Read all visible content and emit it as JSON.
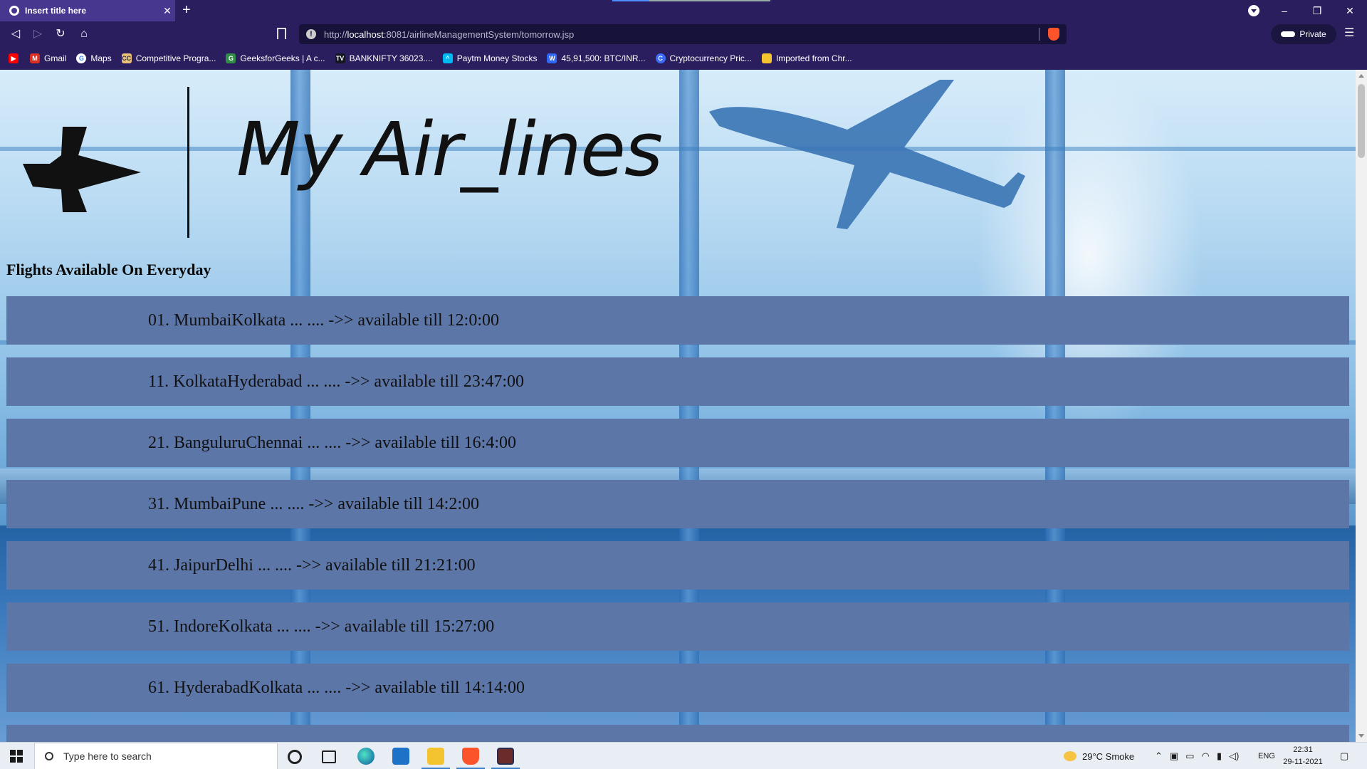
{
  "browser": {
    "tab_title": "Insert title here",
    "tab_close": "✕",
    "new_tab": "+",
    "url_prefix": "http://",
    "url_host": "localhost",
    "url_rest": ":8081/airlineManagementSystem/tomorrow.jsp",
    "private_label": "Private",
    "window_controls": {
      "minimize": "–",
      "restore": "❐",
      "close": "✕"
    },
    "bookmarks": [
      {
        "label": "Gmail",
        "icon": "gmail-icon",
        "color": "#d93025"
      },
      {
        "label": "Maps",
        "icon": "google-icon",
        "color": "#ffffff"
      },
      {
        "label": "Competitive Progra...",
        "icon": "codechef-icon",
        "color": "#e8c07a"
      },
      {
        "label": "GeeksforGeeks | A c...",
        "icon": "geeksforgeeks-icon",
        "color": "#2f8d46"
      },
      {
        "label": "BANKNIFTY 36023....",
        "icon": "tradingview-icon",
        "color": "#131722"
      },
      {
        "label": "Paytm Money Stocks",
        "icon": "paytm-icon",
        "color": "#00baf2"
      },
      {
        "label": "45,91,500: BTC/INR...",
        "icon": "wazirx-icon",
        "color": "#3067f0"
      },
      {
        "label": "Cryptocurrency Pric...",
        "icon": "coingecko-icon",
        "color": "#3b6cf6"
      },
      {
        "label": "Imported from Chr...",
        "icon": "folder-icon",
        "color": "#f4c430"
      }
    ]
  },
  "page": {
    "brand": "My Air_lines",
    "section_title": "Flights Available On Everyday",
    "flights": [
      "01. MumbaiKolkata ... .... ->> available till 12:0:00",
      "11. KolkataHyderabad ... .... ->> available till 23:47:00",
      "21. BanguluruChennai ... .... ->> available till 16:4:00",
      "31. MumbaiPune ... .... ->> available till 14:2:00",
      "41. JaipurDelhi ... .... ->> available till 21:21:00",
      "51. IndoreKolkata ... .... ->> available till 15:27:00",
      "61. HyderabadKolkata ... .... ->> available till 14:14:00"
    ]
  },
  "taskbar": {
    "search_placeholder": "Type here to search",
    "weather": "29°C  Smoke",
    "language": "ENG",
    "time": "22:31",
    "date": "29-11-2021"
  },
  "colors": {
    "chrome": "#2b1e5e",
    "active_tab": "#47378f",
    "flight_row": "#5d76a8",
    "brave": "#fb542b"
  }
}
